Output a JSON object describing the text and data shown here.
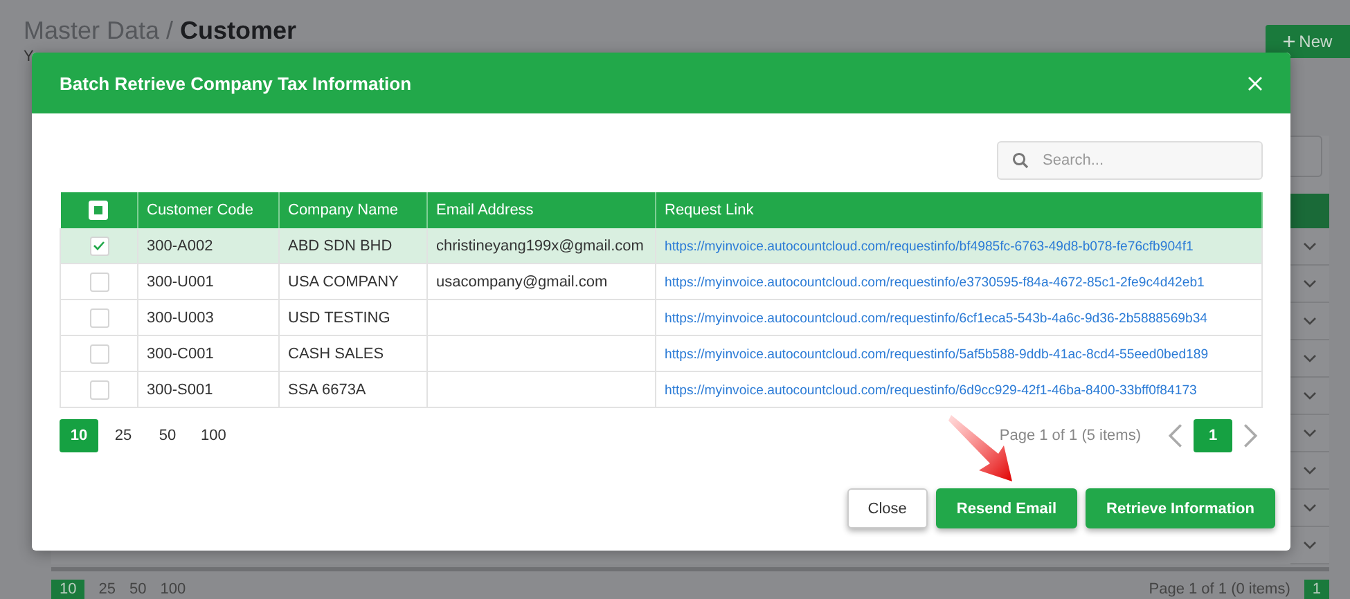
{
  "page": {
    "breadcrumb": "Master Data / ",
    "title": "Customer",
    "subtitle": "Y",
    "new_button": "New",
    "pager": {
      "sizes": [
        {
          "label": "10",
          "selected": true
        },
        {
          "label": "25",
          "selected": false
        },
        {
          "label": "50",
          "selected": false
        },
        {
          "label": "100",
          "selected": false
        }
      ],
      "info": "Page 1 of 1 (0 items)",
      "pages": [
        {
          "label": "1",
          "selected": true
        }
      ]
    }
  },
  "dialog": {
    "title": "Batch Retrieve Company Tax Information",
    "search": {
      "placeholder": "Search..."
    },
    "table": {
      "select_all": {
        "indeterminate": true
      },
      "columns": [
        "Customer Code",
        "Company Name",
        "Email Address",
        "Request Link"
      ],
      "rows": [
        {
          "checked": true,
          "code": "300-A002",
          "company": "ABD SDN BHD",
          "email": "christineyang199x@gmail.com",
          "link": "https://myinvoice.autocountcloud.com/requestinfo/bf4985fc-6763-49d8-b078-fe76cfb904f1"
        },
        {
          "checked": false,
          "code": "300-U001",
          "company": "USA COMPANY",
          "email": "usacompany@gmail.com",
          "link": "https://myinvoice.autocountcloud.com/requestinfo/e3730595-f84a-4672-85c1-2fe9c4d42eb1"
        },
        {
          "checked": false,
          "code": "300-U003",
          "company": "USD TESTING",
          "email": "",
          "link": "https://myinvoice.autocountcloud.com/requestinfo/6cf1eca5-543b-4a6c-9d36-2b5888569b34"
        },
        {
          "checked": false,
          "code": "300-C001",
          "company": "CASH SALES",
          "email": "",
          "link": "https://myinvoice.autocountcloud.com/requestinfo/5af5b588-9ddb-41ac-8cd4-55eed0bed189"
        },
        {
          "checked": false,
          "code": "300-S001",
          "company": "SSA 6673A",
          "email": "",
          "link": "https://myinvoice.autocountcloud.com/requestinfo/6d9cc929-42f1-46ba-8400-33bff0f84173"
        }
      ]
    },
    "pager": {
      "sizes": [
        {
          "label": "10",
          "selected": true
        },
        {
          "label": "25",
          "selected": false
        },
        {
          "label": "50",
          "selected": false
        },
        {
          "label": "100",
          "selected": false
        }
      ],
      "info": "Page 1 of 1 (5 items)",
      "pages": [
        {
          "label": "1",
          "selected": true
        }
      ]
    },
    "buttons": [
      {
        "label": "Close",
        "kind": "secondary"
      },
      {
        "label": "Resend Email",
        "kind": "primary"
      },
      {
        "label": "Retrieve Information",
        "kind": "primary"
      }
    ]
  }
}
